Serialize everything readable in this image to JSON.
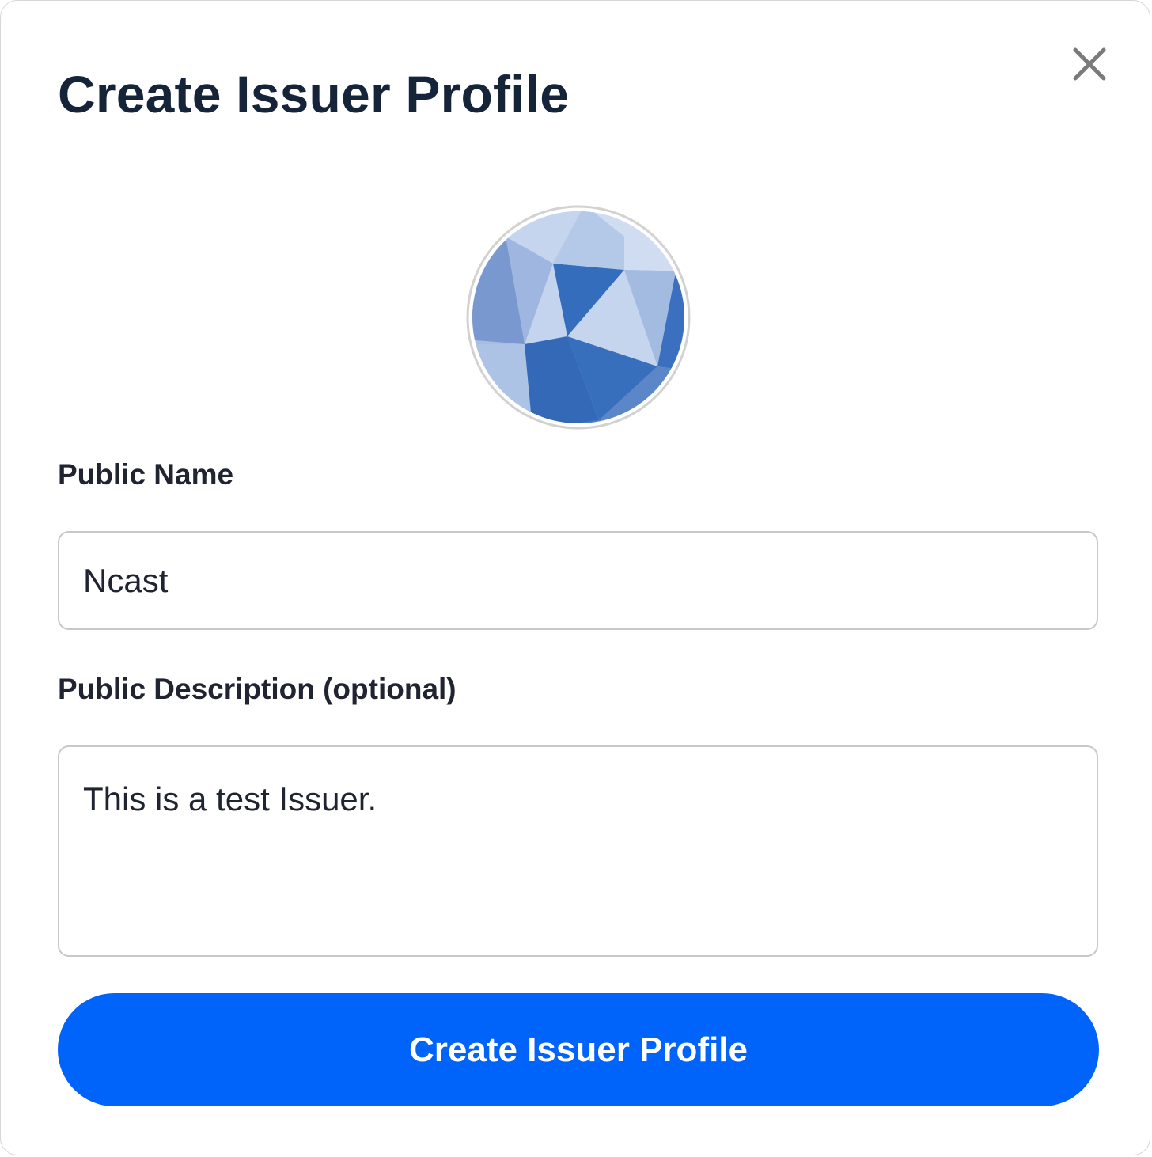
{
  "modal": {
    "title": "Create Issuer Profile",
    "close_icon": "close-icon",
    "avatar_icon": "geometric-avatar-icon"
  },
  "form": {
    "public_name": {
      "label": "Public Name",
      "value": "Ncast"
    },
    "public_description": {
      "label": "Public Description (optional)",
      "value": "This is a test Issuer."
    },
    "submit_label": "Create Issuer Profile"
  },
  "colors": {
    "primary_button": "#0064fb",
    "title_text": "#16243a",
    "avatar_dark": "#336dbb",
    "avatar_light": "#c6d5ed"
  }
}
